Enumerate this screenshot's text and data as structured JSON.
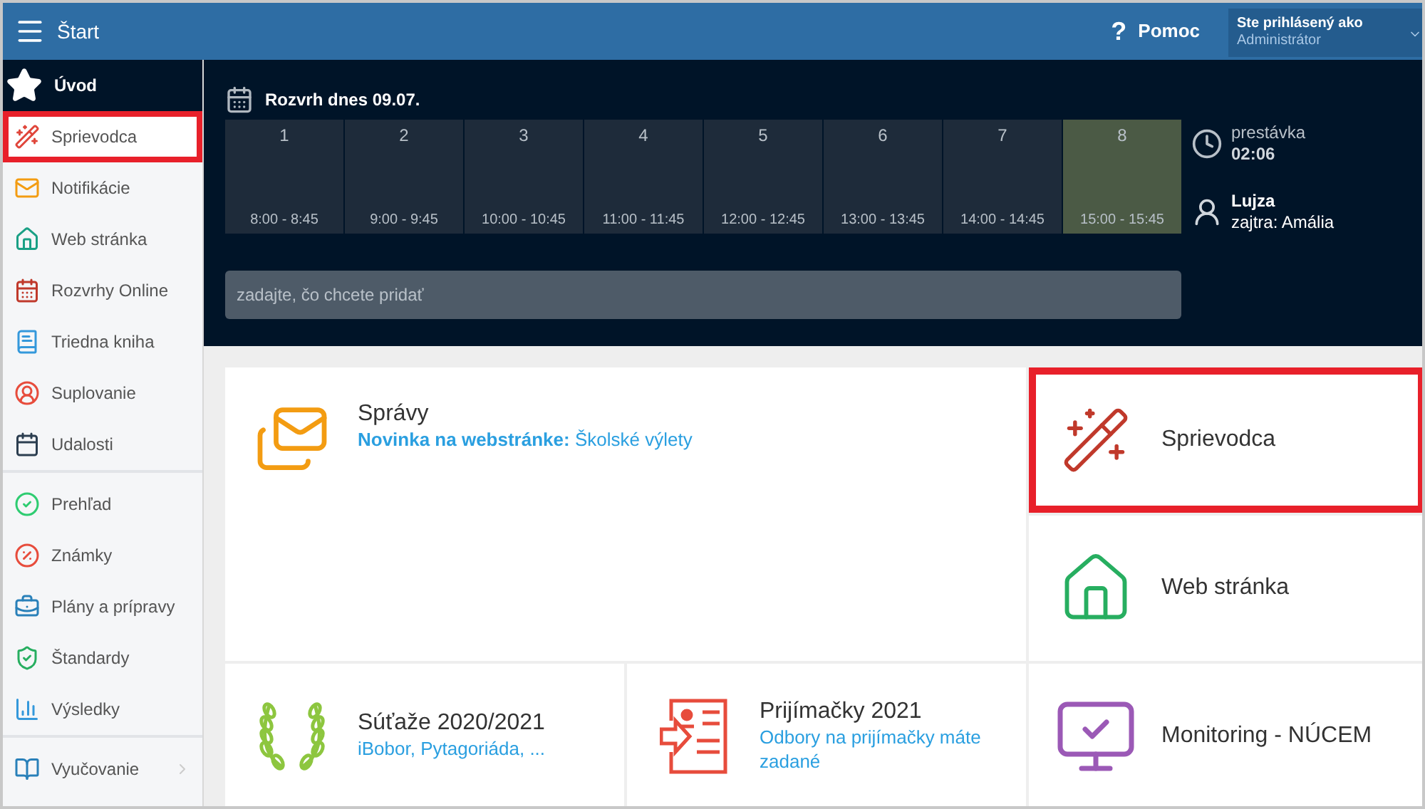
{
  "topbar": {
    "title": "Štart",
    "help_glyph": "?",
    "help": "Pomoc",
    "user_label": "Ste prihlásený ako",
    "user_name": "Administrátor"
  },
  "sidebar": {
    "header": {
      "label": "Úvod",
      "selected": true
    },
    "groups": [
      [
        {
          "label": "Sprievodca",
          "highlighted": true
        },
        {
          "label": "Notifikácie",
          "highlighted": false
        },
        {
          "label": "Web stránka",
          "highlighted": false
        },
        {
          "label": "Rozvrhy Online",
          "highlighted": false
        },
        {
          "label": "Triedna kniha",
          "highlighted": false
        },
        {
          "label": "Suplovanie",
          "highlighted": false
        },
        {
          "label": "Udalosti",
          "highlighted": false
        }
      ],
      [
        {
          "label": "Prehľad",
          "highlighted": false
        },
        {
          "label": "Známky",
          "highlighted": false
        },
        {
          "label": "Plány a prípravy",
          "highlighted": false
        },
        {
          "label": "Štandardy",
          "highlighted": false
        },
        {
          "label": "Výsledky",
          "highlighted": false
        }
      ],
      [
        {
          "label": "Vyučovanie",
          "highlighted": false,
          "has_submenu": true
        }
      ]
    ]
  },
  "schedule": {
    "title": "Rozvrh dnes 09.07.",
    "lessons": [
      {
        "number": "1",
        "time": "8:00 - 8:45",
        "current": false
      },
      {
        "number": "2",
        "time": "9:00 - 9:45",
        "current": false
      },
      {
        "number": "3",
        "time": "10:00 - 10:45",
        "current": false
      },
      {
        "number": "4",
        "time": "11:00 - 11:45",
        "current": false
      },
      {
        "number": "5",
        "time": "12:00 - 12:45",
        "current": false
      },
      {
        "number": "6",
        "time": "13:00 - 13:45",
        "current": false
      },
      {
        "number": "7",
        "time": "14:00 - 14:45",
        "current": false
      },
      {
        "number": "8",
        "time": "15:00 - 15:45",
        "current": true
      }
    ],
    "search": {
      "placeholder": "zadajte, čo chcete pridať"
    },
    "break": {
      "label": "prestávka",
      "time": "02:06"
    },
    "duty": {
      "name": "Lujza",
      "tomorrow": "zajtra: Amália"
    }
  },
  "tiles": [
    {
      "title": "Správy",
      "subtitle_bold": "Novinka na webstránke:",
      "subtitle": "Školské výlety",
      "highlighted": false
    },
    {
      "title": "Sprievodca",
      "highlighted": true
    },
    {
      "title": "Web stránka",
      "highlighted": false
    },
    {
      "title": "Súťaže 2020/2021",
      "subtitle": "iBobor, Pytagoriáda, ...",
      "highlighted": false
    },
    {
      "title": "Prijímačky 2021",
      "subtitle": "Odbory na prijímačky máte zadané",
      "highlighted": false
    },
    {
      "title": "Monitoring - NÚCEM",
      "highlighted": false
    }
  ]
}
